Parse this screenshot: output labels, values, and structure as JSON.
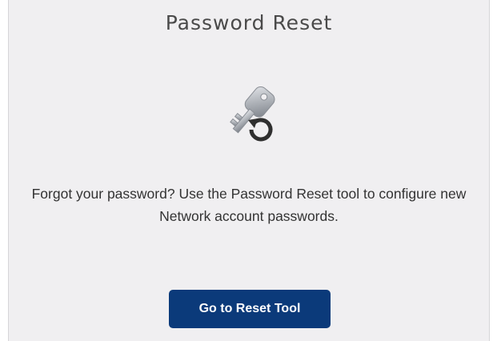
{
  "card": {
    "title": "Password Reset",
    "icon": "key-reset-icon",
    "description": "Forgot your password? Use the Password Reset tool to configure new Network account passwords.",
    "button_label": "Go to Reset Tool"
  },
  "colors": {
    "panel_background": "#f0eff1",
    "button_background": "#0b3a7a",
    "button_text": "#ffffff",
    "title_text": "#4a4a4a",
    "body_text": "#333333"
  }
}
